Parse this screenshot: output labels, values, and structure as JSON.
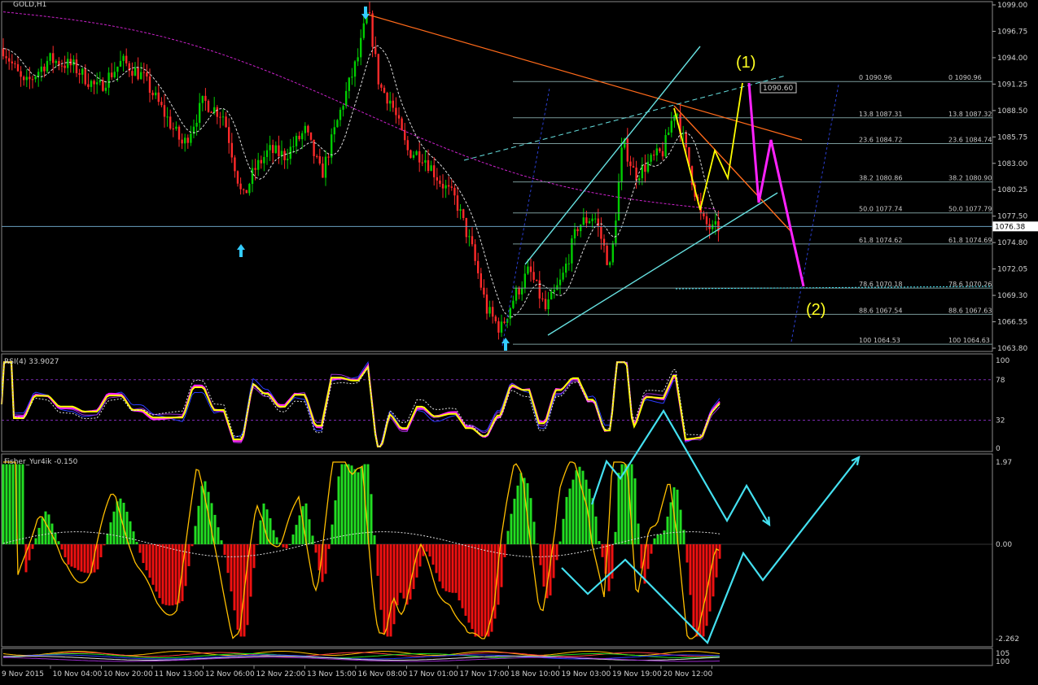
{
  "window": {
    "symbol_title": "GOLD,H1"
  },
  "current_price_label": "1076.38",
  "callout_label": "1090.60",
  "wave_labels": {
    "w1": "(1)",
    "w2": "(2)"
  },
  "panels": {
    "rsi": {
      "title": "RSI(4) 33.9027",
      "levels": [
        "100",
        "78",
        "32",
        "0"
      ],
      "level_values": [
        100,
        78,
        32,
        0
      ]
    },
    "fisher": {
      "title": "Fisher_Yur4ik -0.150",
      "levels": [
        "1.97",
        "0.00",
        "-2.262"
      ],
      "level_values": [
        1.97,
        0,
        -2.262
      ]
    },
    "bottom": {
      "title": "",
      "levels": [
        "105",
        "100"
      ]
    }
  },
  "price_axis": [
    "1099.00",
    "1096.75",
    "1094.00",
    "1091.25",
    "1088.50",
    "1085.75",
    "1083.00",
    "1080.25",
    "1077.50",
    "1074.80",
    "1072.05",
    "1069.30",
    "1066.55",
    "1063.80"
  ],
  "time_axis": [
    "9 Nov 2015",
    "10 Nov 04:00",
    "10 Nov 20:00",
    "11 Nov 13:00",
    "12 Nov 06:00",
    "12 Nov 22:00",
    "13 Nov 15:00",
    "16 Nov 08:00",
    "17 Nov 01:00",
    "17 Nov 17:00",
    "18 Nov 10:00",
    "19 Nov 03:00",
    "19 Nov 19:00",
    "20 Nov 12:00"
  ],
  "fib_levels": [
    {
      "pct": "0",
      "left": "0 1090.96",
      "right": "0 1090.96",
      "price": 1090.96
    },
    {
      "pct": "13.8",
      "left": "13.8 1087.31",
      "right": "13.8 1087.32",
      "price": 1087.31
    },
    {
      "pct": "23.6",
      "left": "23.6 1084.72",
      "right": "23.6 1084.74",
      "price": 1084.72
    },
    {
      "pct": "38.2",
      "left": "38.2 1080.86",
      "right": "38.2 1080.90",
      "price": 1080.86
    },
    {
      "pct": "50.0",
      "left": "50.0 1077.74",
      "right": "50.0 1077.79",
      "price": 1077.74
    },
    {
      "pct": "61.8",
      "left": "61.8 1074.62",
      "right": "61.8 1074.69",
      "price": 1074.62
    },
    {
      "pct": "78.6",
      "left": "78.6 1070.18",
      "right": "78.6 1070.26",
      "price": 1070.18
    },
    {
      "pct": "88.6",
      "left": "88.6 1067.54",
      "right": "88.6 1067.63",
      "price": 1067.54
    },
    {
      "pct": "100",
      "left": "100 1064.53",
      "right": "100 1064.63",
      "price": 1064.53
    }
  ],
  "colors": {
    "background": "#000000",
    "bull": "#00cc00",
    "bear": "#ff2a2a",
    "grid": "#3a3a3a",
    "fib": "#7a9a9a",
    "channel": "#66e0e0",
    "trend": "#ff6a1a",
    "wave_yellow": "#ffff00",
    "wave_magenta": "#ff22ff",
    "ma_magenta": "#cc22cc",
    "ma_white": "#dcdcdc",
    "arrow_cyan": "#33ccff",
    "fisher_pos": "#22dd22",
    "fisher_neg": "#ee1111",
    "fisher_line": "#ffbf00",
    "projection": "#44e0f0"
  },
  "icons": [
    "up-arrow-icon",
    "down-arrow-icon"
  ],
  "chart_data": {
    "type": "candlestick",
    "title": "GOLD,H1",
    "ylim": [
      1063.8,
      1099.0
    ],
    "x_range": [
      "9 Nov 2015",
      "20 Nov 12:00"
    ],
    "current_price": 1076.38,
    "key_points": {
      "high": 1098.2,
      "low": 1064.5,
      "target_1": 1090.6,
      "target_2": 1070.2
    },
    "grid": false
  }
}
